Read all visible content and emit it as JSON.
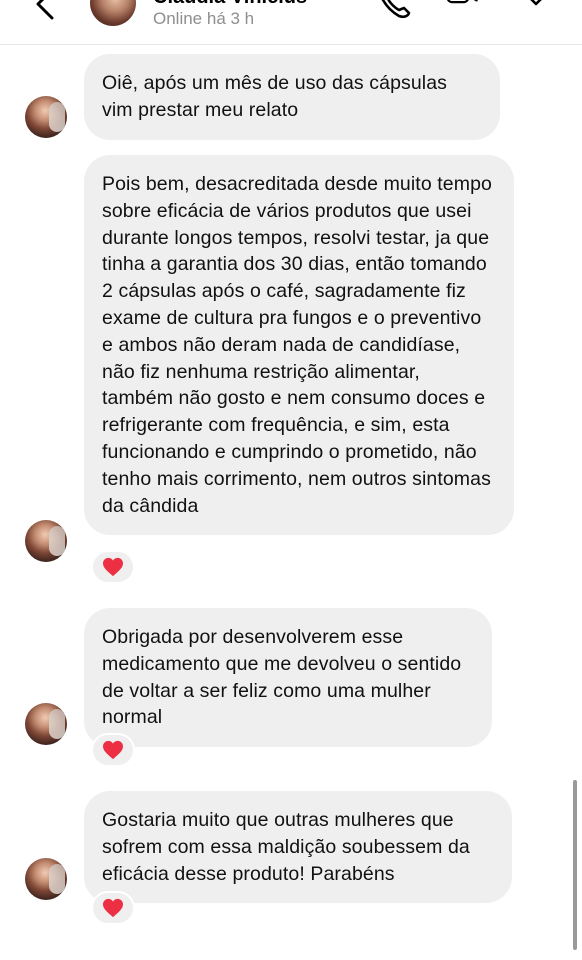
{
  "header": {
    "contact_name": "Claudia Vinicius",
    "status": "Online há 3 h",
    "icons": [
      "chevron-left-icon",
      "phone-icon",
      "video-camera-icon",
      "tag-icon"
    ]
  },
  "messages": [
    {
      "text": "Oiê, após um mês de uso das cápsulas vim prestar meu relato",
      "reaction": ""
    },
    {
      "text": "Pois bem, desacreditada desde muito tempo sobre eficácia de vários produtos que usei durante longos tempos, resolvi testar, ja que tinha a garantia dos 30 dias, então tomando 2 cápsulas após o café, sagradamente fiz exame de cultura pra fungos e o preventivo e ambos não deram nada de candidíase, não fiz nenhuma restrição alimentar, também não gosto e nem consumo doces e refrigerante com frequência, e sim, esta funcionando e cumprindo o prometido, não tenho mais corrimento, nem outros sintomas da cândida",
      "reaction": "❤️"
    },
    {
      "text": "Obrigada por desenvolverem esse medicamento que me devolveu o sentido de voltar a ser feliz como uma mulher normal",
      "reaction": "❤️"
    },
    {
      "text": "Gostaria muito que outras mulheres que sofrem com essa maldição soubessem da eficácia desse produto! Parabéns",
      "reaction": "❤️"
    }
  ],
  "colors": {
    "bubble_bg": "#efefef",
    "status_text": "#8e8e8e",
    "reaction_heart": "#ed2f44"
  }
}
